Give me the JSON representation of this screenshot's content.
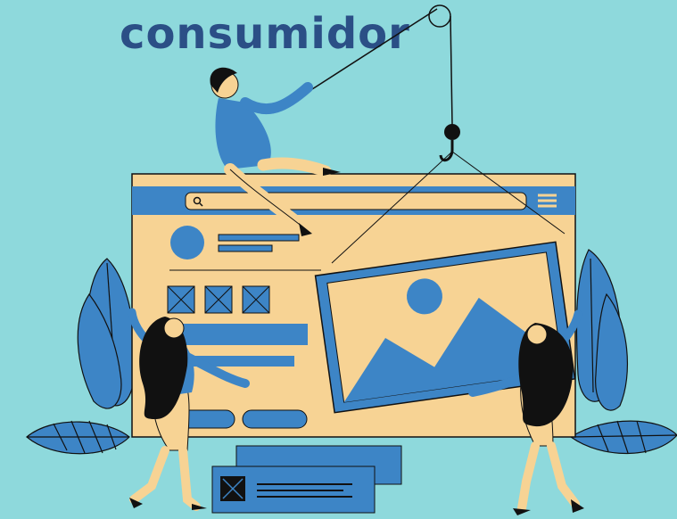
{
  "headline": "consumidor",
  "mockup": {
    "search_icon": "search-icon",
    "menu_icon": "hamburger-menu-icon",
    "image_icon": "image-placeholder-icon",
    "checkbox_icon": "x-box-icon"
  },
  "colors": {
    "background": "#8ed9dc",
    "blue": "#3d85c6",
    "dark_blue": "#2b4f86",
    "peach": "#f7d394",
    "black": "#111111"
  }
}
